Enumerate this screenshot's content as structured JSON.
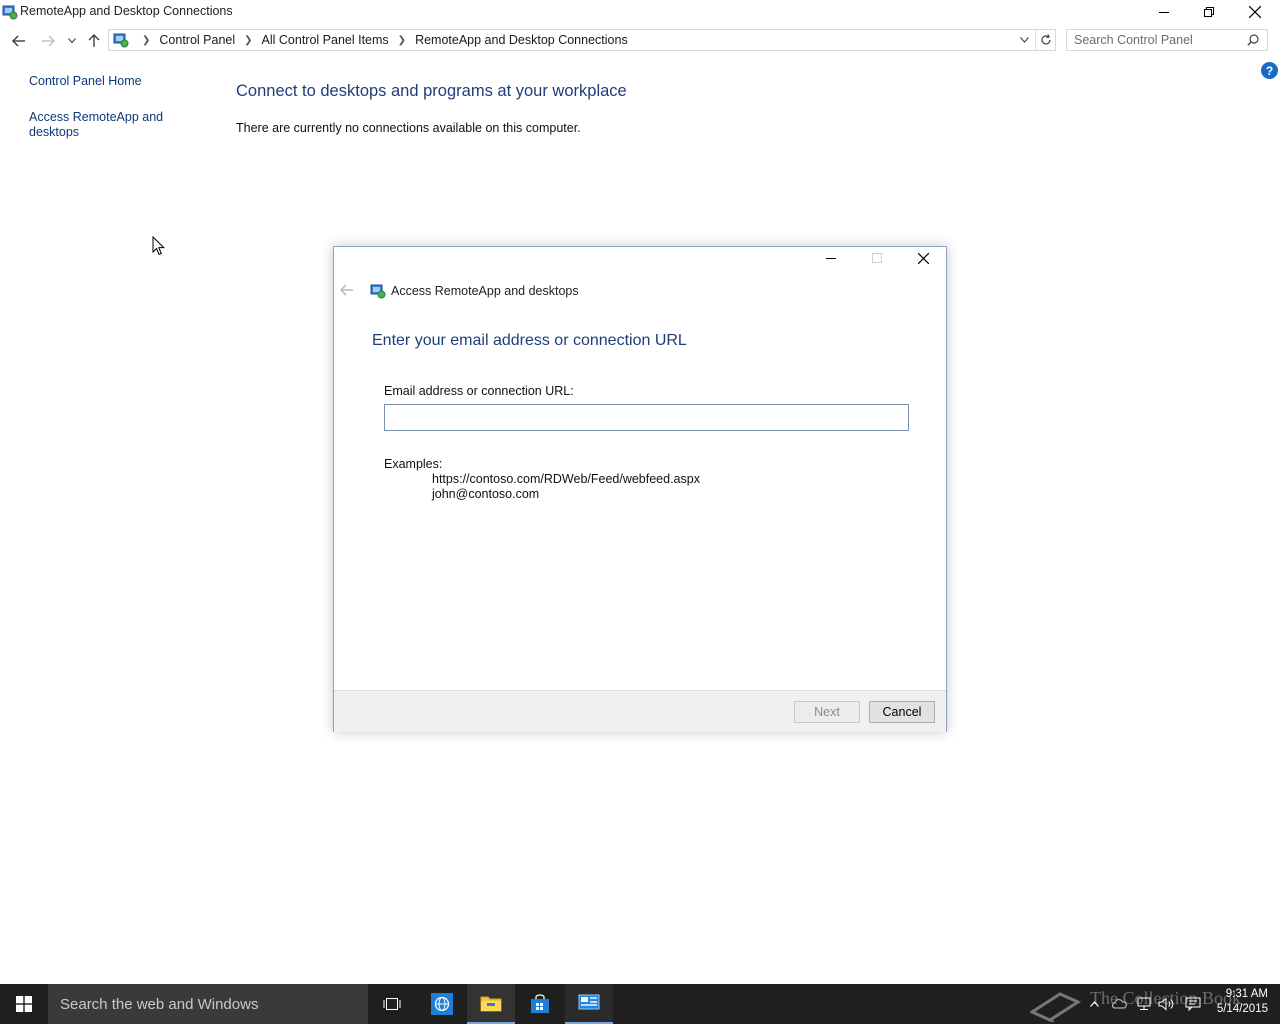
{
  "window": {
    "title": "RemoteApp and Desktop Connections"
  },
  "address_bar": {
    "breadcrumbs": [
      "Control Panel",
      "All Control Panel Items",
      "RemoteApp and Desktop Connections"
    ],
    "search_placeholder": "Search Control Panel"
  },
  "left_pane": {
    "home_link": "Control Panel Home",
    "access_link_line1": "Access RemoteApp and",
    "access_link_line2": "desktops"
  },
  "main": {
    "heading": "Connect to desktops and programs at your workplace",
    "status": "There are currently no connections available on this computer."
  },
  "help_label": "?",
  "dialog": {
    "title": "Access RemoteApp and desktops",
    "heading": "Enter your email address or connection URL",
    "field_label": "Email address or connection URL:",
    "field_value": "",
    "examples_label": "Examples:",
    "examples": [
      "https://contoso.com/RDWeb/Feed/webfeed.aspx",
      "john@contoso.com"
    ],
    "next_label": "Next",
    "cancel_label": "Cancel"
  },
  "taskbar": {
    "search_placeholder": "Search the web and Windows",
    "watermark": "The Collection Book",
    "time": "9:31 AM",
    "date": "5/14/2015"
  },
  "colors": {
    "link": "#0b3a7a",
    "heading": "#1e3d7b",
    "taskbar": "#1f1f1f",
    "accent": "#1a68c8"
  }
}
